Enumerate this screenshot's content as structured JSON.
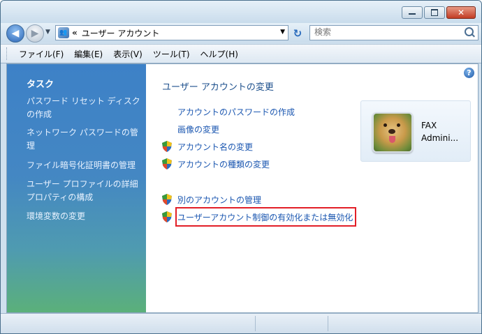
{
  "window": {
    "caption_buttons": {
      "minimize": "minimize",
      "maximize": "maximize",
      "close": "✕"
    }
  },
  "nav": {
    "back_icon": "◀",
    "forward_icon": "▶",
    "address": {
      "chevron": "«",
      "path": "ユーザー アカウント"
    },
    "refresh_icon": "↻",
    "search_placeholder": "検索"
  },
  "menu": {
    "items": [
      "ファイル(F)",
      "編集(E)",
      "表示(V)",
      "ツール(T)",
      "ヘルプ(H)"
    ]
  },
  "tasks": {
    "title": "タスク",
    "items": [
      "パスワード リセット ディスクの作成",
      "ネットワーク パスワードの管理",
      "ファイル暗号化証明書の管理",
      "ユーザー プロファイルの詳細プロパティの構成",
      "環境変数の変更"
    ]
  },
  "main": {
    "help_icon": "?",
    "title": "ユーザー アカウントの変更",
    "links": [
      "アカウントのパスワードの作成",
      "画像の変更",
      "アカウント名の変更",
      "アカウントの種類の変更",
      "別のアカウントの管理",
      "ユーザーアカウント制御の有効化または無効化"
    ]
  },
  "account": {
    "name": "FAX",
    "role": "Admini..."
  },
  "colors": {
    "highlight_border": "#e21e26",
    "link": "#1a56b0",
    "task_panel": "#3d81c7"
  }
}
